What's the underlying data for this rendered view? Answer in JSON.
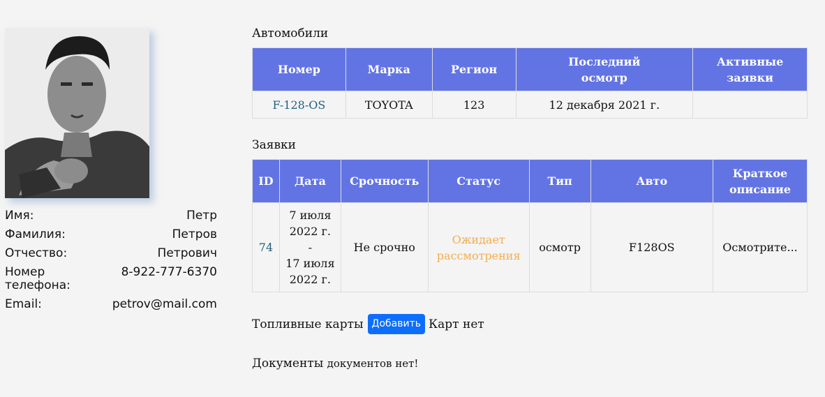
{
  "profile": {
    "rows": [
      {
        "label": "Имя:",
        "value": "Петр"
      },
      {
        "label": "Фамилия:",
        "value": "Петров"
      },
      {
        "label": "Отчество:",
        "value": "Петрович"
      },
      {
        "label": "Номер телефона:",
        "value": "8-922-777-6370"
      },
      {
        "label": "Email:",
        "value": "petrov@mail.com"
      }
    ]
  },
  "cars": {
    "title": "Автомобили",
    "headers": [
      "Номер",
      "Марка",
      "Регион",
      "Последний осмотр",
      "Активные заявки"
    ],
    "rows": [
      {
        "number": "F-128-OS",
        "brand": "TOYOTA",
        "region": "123",
        "last_inspection": "12 декабря 2021 г.",
        "active_requests": ""
      }
    ]
  },
  "requests": {
    "title": "Заявки",
    "headers": [
      "ID",
      "Дата",
      "Срочность",
      "Статус",
      "Тип",
      "Авто",
      "Краткое описание"
    ],
    "rows": [
      {
        "id": "74",
        "date_from": "7 июля 2022 г.",
        "date_sep": "-",
        "date_to": "17 июля 2022 г.",
        "urgency": "Не срочно",
        "status": "Ожидает рассмотрения",
        "type": "осмотр",
        "car": "F128OS",
        "description": "Осмотрите..."
      }
    ]
  },
  "fuel_cards": {
    "title": "Топливные карты",
    "add_label": "Добавить",
    "empty_text": "Карт нет"
  },
  "documents": {
    "title": "Документы",
    "empty_text": "документов нет!"
  },
  "colors": {
    "table_header": "#6274e4",
    "link": "#22607e",
    "status_pending": "#f4ad4e",
    "primary_button": "#0d6efd"
  }
}
